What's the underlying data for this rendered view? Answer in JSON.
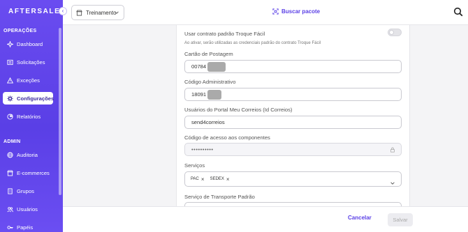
{
  "brand": {
    "logo_text": "AFTERSALE"
  },
  "sidebar": {
    "section_operacoes": "OPERAÇÕES",
    "section_admin": "ADMIN",
    "items": [
      {
        "label": "Dashboard",
        "icon": "sparkle-icon"
      },
      {
        "label": "Solicitações",
        "icon": "list-icon"
      },
      {
        "label": "Exceções",
        "icon": "warning-icon"
      },
      {
        "label": "Configurações",
        "icon": "gear-icon",
        "active": true
      },
      {
        "label": "Relatórios",
        "icon": "chart-icon"
      },
      {
        "label": "Auditoria",
        "icon": "globe-icon"
      },
      {
        "label": "E-commerces",
        "icon": "store-icon"
      },
      {
        "label": "Grupos",
        "icon": "building-icon"
      },
      {
        "label": "Usuários",
        "icon": "users-icon"
      },
      {
        "label": "Papéis",
        "icon": "key-icon"
      }
    ]
  },
  "topbar": {
    "selector_value": "Treinamento",
    "search_package_label": "Buscar pacote"
  },
  "form": {
    "toggle_label": "Usar contrato padrão Troque Fácil",
    "toggle_hint": "Ao ativar, serão utilizadas as credenciais padrão do contrato Troque Fácil",
    "toggle_on": false,
    "cartao_label": "Cartão de Postagem",
    "cartao_value": "00784",
    "codigo_admin_label": "Código Administrativo",
    "codigo_admin_value": "18091",
    "usuarios_label": "Usuários do Portal Meu Correios (Id Correios)",
    "usuarios_value": "send4correios",
    "codigo_acesso_label": "Código de acesso aos componentes",
    "codigo_acesso_value": "••••••••••",
    "servicos_label": "Serviços",
    "servicos_chips": [
      "PAC",
      "SEDEX"
    ],
    "transporte_label": "Serviço de Transporte Padrão"
  },
  "footer": {
    "cancel_label": "Cancelar",
    "save_label": "Salvar"
  },
  "colors": {
    "accent": "#5a3fe6",
    "sidebar_bg": "#6a4cf0"
  }
}
